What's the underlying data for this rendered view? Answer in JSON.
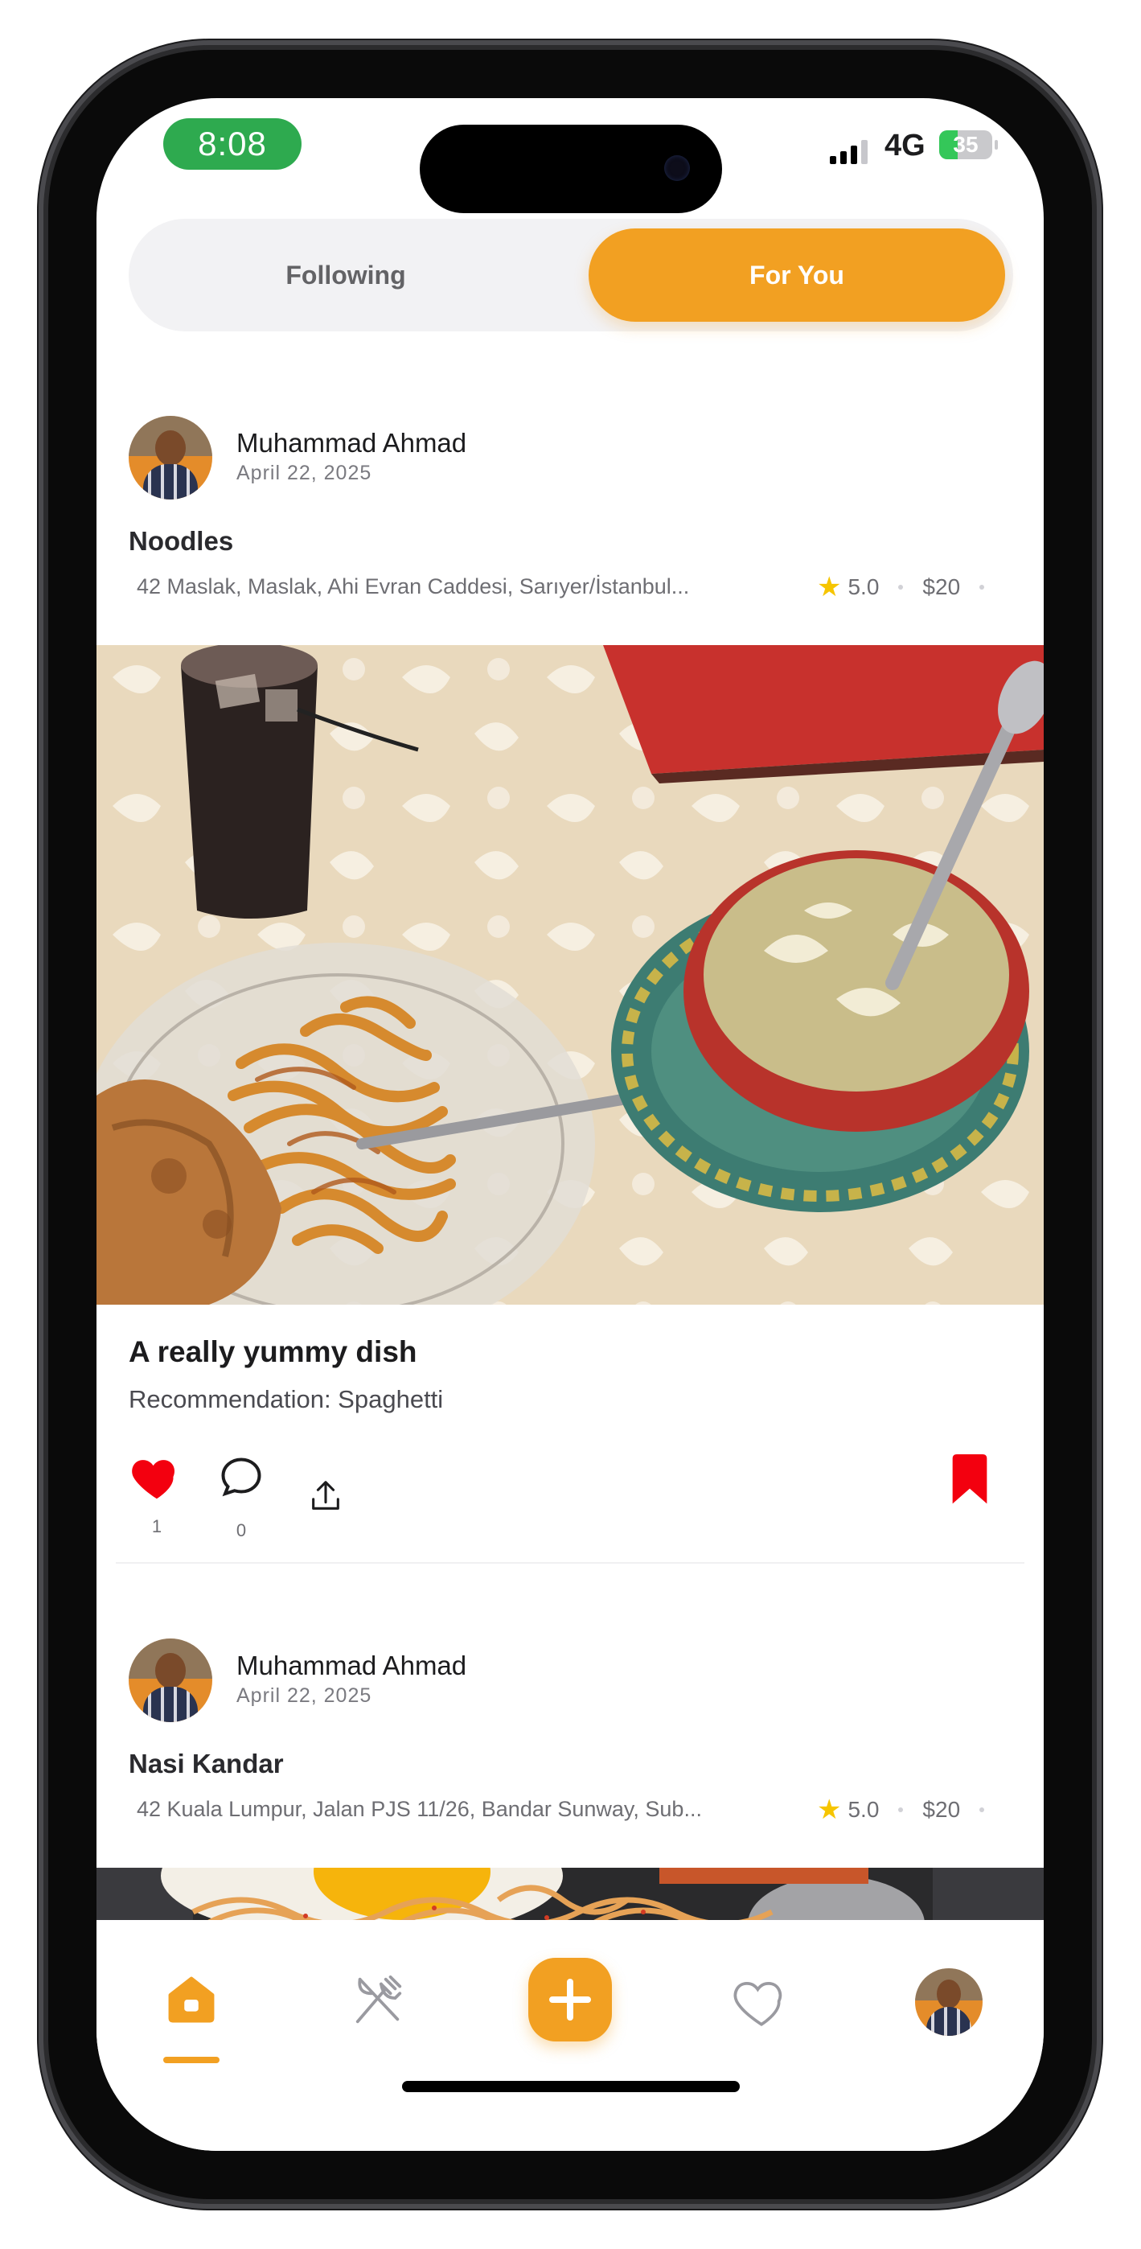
{
  "status_bar": {
    "time": "8:08",
    "network": "4G",
    "battery": "35",
    "battery_level": 0.35
  },
  "tabs": {
    "following": "Following",
    "for_you": "For You",
    "active": "for_you"
  },
  "posts": [
    {
      "author": "Muhammad Ahmad",
      "date": "April 22, 2025",
      "dish": "Noodles",
      "address": "42 Maslak, Maslak, Ahi Evran Caddesi, Sarıyer/İstanbul...",
      "rating": "5.0",
      "price": "$20",
      "title": "A really yummy dish",
      "recommendation": "Recommendation: Spaghetti",
      "likes": "1",
      "comments": "0",
      "liked": true,
      "saved": true
    },
    {
      "author": "Muhammad Ahmad",
      "date": "April 22, 2025",
      "dish": "Nasi Kandar",
      "address": "42 Kuala Lumpur, Jalan PJS 11/26, Bandar Sunway, Sub...",
      "rating": "5.0",
      "price": "$20"
    }
  ],
  "nav": {
    "items": [
      "home-icon",
      "fork-knife-icon",
      "add-icon",
      "heart-icon",
      "profile-avatar"
    ],
    "active": "home-icon"
  },
  "colors": {
    "accent": "#f2a022",
    "like": "#f3000f",
    "bookmark": "#f3000f",
    "star": "#f6c500"
  }
}
